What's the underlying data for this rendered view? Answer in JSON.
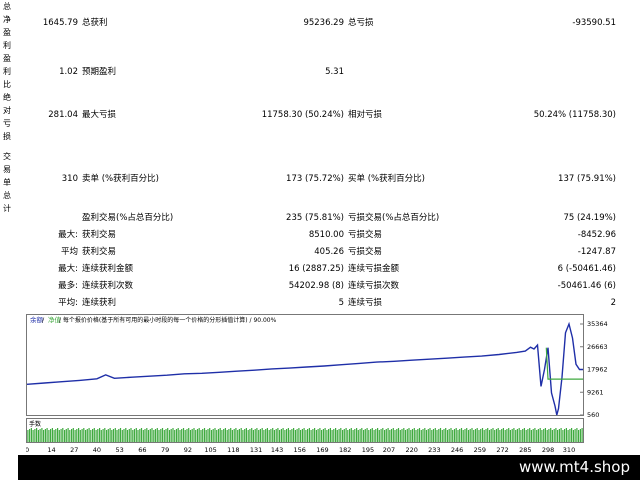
{
  "report": {
    "section_labels": [
      "总净盈利",
      "盈利比",
      "绝对亏损",
      "交易单总计"
    ],
    "rows": [
      {
        "c1": "1645.79",
        "l2": "总获利",
        "v2": "95236.29",
        "l3": "总亏损",
        "v3": "-93590.51"
      },
      {
        "c1": "1.02",
        "l2": "预期盈利",
        "v2": "5.31",
        "l3": "",
        "v3": ""
      },
      {
        "c1": "281.04",
        "l2": "最大亏损",
        "v2": "11758.30 (50.24%)",
        "l3": "相对亏损",
        "v3": "50.24% (11758.30)"
      },
      {
        "c1": "310",
        "l2": "卖单 (%获利百分比)",
        "v2": "173 (75.72%)",
        "l3": "买单 (%获利百分比)",
        "v3": "137 (75.91%)"
      },
      {
        "c1": "",
        "l2": "盈利交易(%占总百分比)",
        "v2": "235 (75.81%)",
        "l3": "亏损交易(%占总百分比)",
        "v3": "75 (24.19%)"
      },
      {
        "c1": "最大:",
        "l2": "获利交易",
        "v2": "8510.00",
        "l3": "亏损交易",
        "v3": "-8452.96"
      },
      {
        "c1": "平均",
        "l2": "获利交易",
        "v2": "405.26",
        "l3": "亏损交易",
        "v3": "-1247.87"
      },
      {
        "c1": "最大:",
        "l2": "连续获利金额",
        "v2": "16 (2887.25)",
        "l3": "连续亏损金额",
        "v3": "6 (-50461.46)"
      },
      {
        "c1": "最多:",
        "l2": "连续获利次数",
        "v2": "54202.98 (8)",
        "l3": "连续亏损次数",
        "v3": "-50461.46 (6)"
      },
      {
        "c1": "平均:",
        "l2": "连续获利",
        "v2": "5",
        "l3": "连续亏损",
        "v3": "2"
      }
    ]
  },
  "chart_header": {
    "balance": "余额",
    "sep": " / ",
    "equity": "净值",
    "desc": " / 每个报价价格(基于所有可用的最小时段的每一个价格的分形插值计算) / 90.00%"
  },
  "volume_label": "手数",
  "chart_data": {
    "type": "line",
    "yticks": [
      "35364",
      "26663",
      "17962",
      "9261",
      "560"
    ],
    "xticks": [
      "0",
      "14",
      "27",
      "40",
      "53",
      "66",
      "79",
      "92",
      "105",
      "118",
      "131",
      "143",
      "156",
      "169",
      "182",
      "195",
      "207",
      "220",
      "233",
      "246",
      "259",
      "272",
      "285",
      "298",
      "310"
    ],
    "ylim": [
      560,
      35364
    ],
    "xlim": [
      0,
      318
    ],
    "series": [
      {
        "color": "#1f2fa8",
        "x": [
          0,
          10,
          20,
          30,
          40,
          45,
          50,
          60,
          70,
          80,
          90,
          100,
          110,
          120,
          130,
          140,
          150,
          160,
          170,
          180,
          190,
          200,
          210,
          220,
          230,
          240,
          250,
          260,
          270,
          280,
          285,
          288,
          290,
          292,
          294,
          296,
          298,
          300,
          302,
          303,
          304,
          306,
          308,
          310,
          312,
          314,
          316,
          318
        ],
        "y": [
          12300,
          12800,
          13300,
          13800,
          14400,
          15900,
          14600,
          15000,
          15400,
          15800,
          16300,
          16500,
          16900,
          17300,
          17700,
          18200,
          18500,
          18900,
          19300,
          19800,
          20300,
          20800,
          21100,
          21500,
          21900,
          22300,
          22700,
          23100,
          23700,
          24500,
          25000,
          26500,
          25800,
          27300,
          11500,
          18000,
          26300,
          9000,
          4000,
          560,
          3000,
          15000,
          32000,
          35364,
          30000,
          20000,
          17962,
          17962
        ]
      },
      {
        "color": "#3fa83f",
        "x": [
          297,
          297.5,
          298,
          300,
          318
        ],
        "y": [
          26300,
          20000,
          14300,
          14300,
          14300
        ]
      }
    ]
  },
  "colors": {
    "balance": "#1f2fa8",
    "equity": "#3fa83f",
    "volume": "#3faa3f",
    "footer_bg": "#000000",
    "watermark": "#ffffff"
  },
  "watermark": "www.mt4.shop"
}
